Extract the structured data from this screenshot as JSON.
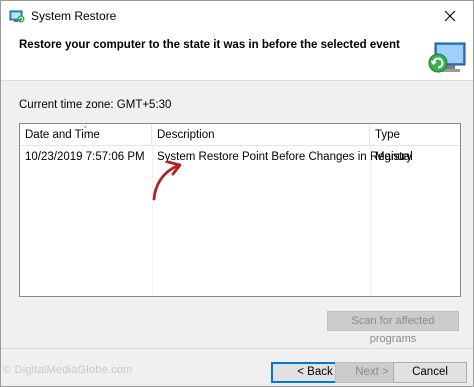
{
  "window": {
    "title": "System Restore",
    "close_icon": "close-icon"
  },
  "header": {
    "title": "Restore your computer to the state it was in before the selected event",
    "art_icon": "system-restore-computer-icon"
  },
  "timezone": {
    "label": "Current time zone: GMT+5:30"
  },
  "restore_list": {
    "columns": [
      "Date and Time",
      "Description",
      "Type"
    ],
    "rows": [
      {
        "date_time": "10/23/2019 7:57:06 PM",
        "description": "System Restore Point Before Changes in Registry",
        "type": "Manual"
      }
    ]
  },
  "buttons": {
    "scan": "Scan for affected programs",
    "back": "< Back",
    "next": "Next >",
    "cancel": "Cancel"
  },
  "watermark": "© DigitalMediaGlobe.com",
  "colors": {
    "annotation_arrow": "#b22222",
    "focus_border": "#0078d7",
    "disabled_fill": "#cccccc"
  }
}
